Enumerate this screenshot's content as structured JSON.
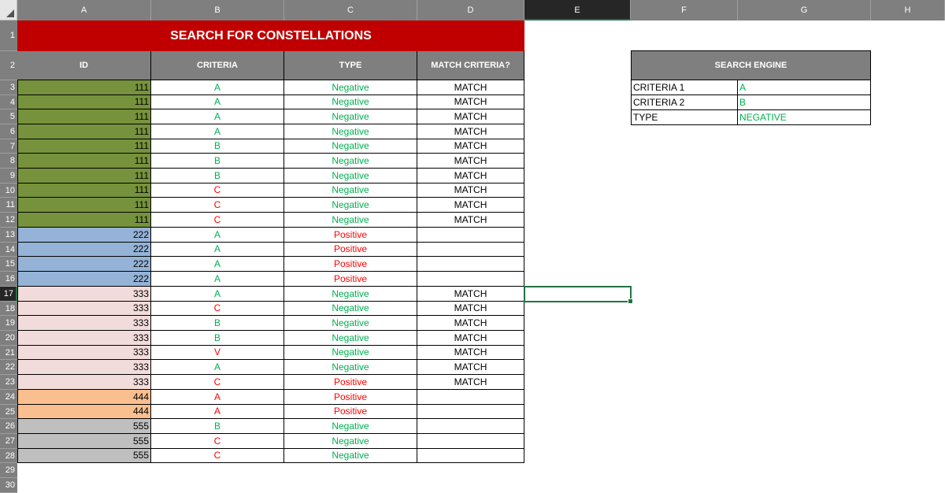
{
  "columns": [
    "A",
    "B",
    "C",
    "D",
    "E",
    "F",
    "G",
    "H"
  ],
  "selected_column": "E",
  "row_numbers": [
    "1",
    "2",
    "3",
    "4",
    "5",
    "6",
    "7",
    "8",
    "9",
    "10",
    "11",
    "12",
    "13",
    "14",
    "15",
    "16",
    "17",
    "18",
    "19",
    "20",
    "21",
    "22",
    "23",
    "24",
    "25",
    "26",
    "27",
    "28",
    "29",
    "30"
  ],
  "selected_row": "17",
  "title": "SEARCH FOR CONSTELLATIONS",
  "table_headers": [
    "ID",
    "CRITERIA",
    "TYPE",
    "MATCH CRITERIA?"
  ],
  "rows": [
    {
      "id": "111",
      "criteria": "A",
      "type": "Negative",
      "match": "MATCH",
      "id_fill": "#76923c",
      "criteria_color": "green",
      "type_color": "green"
    },
    {
      "id": "111",
      "criteria": "A",
      "type": "Negative",
      "match": "MATCH",
      "id_fill": "#76923c",
      "criteria_color": "green",
      "type_color": "green"
    },
    {
      "id": "111",
      "criteria": "A",
      "type": "Negative",
      "match": "MATCH",
      "id_fill": "#76923c",
      "criteria_color": "green",
      "type_color": "green"
    },
    {
      "id": "111",
      "criteria": "A",
      "type": "Negative",
      "match": "MATCH",
      "id_fill": "#76923c",
      "criteria_color": "green",
      "type_color": "green"
    },
    {
      "id": "111",
      "criteria": "B",
      "type": "Negative",
      "match": "MATCH",
      "id_fill": "#76923c",
      "criteria_color": "green",
      "type_color": "green"
    },
    {
      "id": "111",
      "criteria": "B",
      "type": "Negative",
      "match": "MATCH",
      "id_fill": "#76923c",
      "criteria_color": "green",
      "type_color": "green"
    },
    {
      "id": "111",
      "criteria": "B",
      "type": "Negative",
      "match": "MATCH",
      "id_fill": "#76923c",
      "criteria_color": "green",
      "type_color": "green"
    },
    {
      "id": "111",
      "criteria": "C",
      "type": "Negative",
      "match": "MATCH",
      "id_fill": "#76923c",
      "criteria_color": "red",
      "type_color": "green"
    },
    {
      "id": "111",
      "criteria": "C",
      "type": "Negative",
      "match": "MATCH",
      "id_fill": "#76923c",
      "criteria_color": "red",
      "type_color": "green"
    },
    {
      "id": "111",
      "criteria": "C",
      "type": "Negative",
      "match": "MATCH",
      "id_fill": "#76923c",
      "criteria_color": "red",
      "type_color": "green"
    },
    {
      "id": "222",
      "criteria": "A",
      "type": "Positive",
      "match": "",
      "id_fill": "#95b3d7",
      "criteria_color": "green",
      "type_color": "red"
    },
    {
      "id": "222",
      "criteria": "A",
      "type": "Positive",
      "match": "",
      "id_fill": "#95b3d7",
      "criteria_color": "green",
      "type_color": "red"
    },
    {
      "id": "222",
      "criteria": "A",
      "type": "Positive",
      "match": "",
      "id_fill": "#95b3d7",
      "criteria_color": "green",
      "type_color": "red"
    },
    {
      "id": "222",
      "criteria": "A",
      "type": "Positive",
      "match": "",
      "id_fill": "#95b3d7",
      "criteria_color": "green",
      "type_color": "red"
    },
    {
      "id": "333",
      "criteria": "A",
      "type": "Negative",
      "match": "MATCH",
      "id_fill": "#f2dcdb",
      "criteria_color": "green",
      "type_color": "green"
    },
    {
      "id": "333",
      "criteria": "C",
      "type": "Negative",
      "match": "MATCH",
      "id_fill": "#f2dcdb",
      "criteria_color": "red",
      "type_color": "green"
    },
    {
      "id": "333",
      "criteria": "B",
      "type": "Negative",
      "match": "MATCH",
      "id_fill": "#f2dcdb",
      "criteria_color": "green",
      "type_color": "green"
    },
    {
      "id": "333",
      "criteria": "B",
      "type": "Negative",
      "match": "MATCH",
      "id_fill": "#f2dcdb",
      "criteria_color": "green",
      "type_color": "green"
    },
    {
      "id": "333",
      "criteria": "V",
      "type": "Negative",
      "match": "MATCH",
      "id_fill": "#f2dcdb",
      "criteria_color": "red",
      "type_color": "green"
    },
    {
      "id": "333",
      "criteria": "A",
      "type": "Negative",
      "match": "MATCH",
      "id_fill": "#f2dcdb",
      "criteria_color": "green",
      "type_color": "green"
    },
    {
      "id": "333",
      "criteria": "C",
      "type": "Positive",
      "match": "MATCH",
      "id_fill": "#f2dcdb",
      "criteria_color": "red",
      "type_color": "red"
    },
    {
      "id": "444",
      "criteria": "A",
      "type": "Positive",
      "match": "",
      "id_fill": "#fabf8f",
      "criteria_color": "red",
      "type_color": "red"
    },
    {
      "id": "444",
      "criteria": "A",
      "type": "Positive",
      "match": "",
      "id_fill": "#fabf8f",
      "criteria_color": "red",
      "type_color": "red"
    },
    {
      "id": "555",
      "criteria": "B",
      "type": "Negative",
      "match": "",
      "id_fill": "#bfbfbf",
      "criteria_color": "green",
      "type_color": "green"
    },
    {
      "id": "555",
      "criteria": "C",
      "type": "Negative",
      "match": "",
      "id_fill": "#bfbfbf",
      "criteria_color": "red",
      "type_color": "green"
    },
    {
      "id": "555",
      "criteria": "C",
      "type": "Negative",
      "match": "",
      "id_fill": "#bfbfbf",
      "criteria_color": "red",
      "type_color": "green"
    }
  ],
  "search_engine": {
    "header": "SEARCH ENGINE",
    "rows": [
      {
        "label": "CRITERIA 1",
        "value": "A"
      },
      {
        "label": "CRITERIA 2",
        "value": "B"
      },
      {
        "label": "TYPE",
        "value": "NEGATIVE"
      }
    ]
  },
  "colors": {
    "title_bg": "#c00000",
    "header_bg": "#7f7f7f",
    "green_text": "#00b050",
    "red_text": "#ff0000",
    "selection": "#217346"
  }
}
